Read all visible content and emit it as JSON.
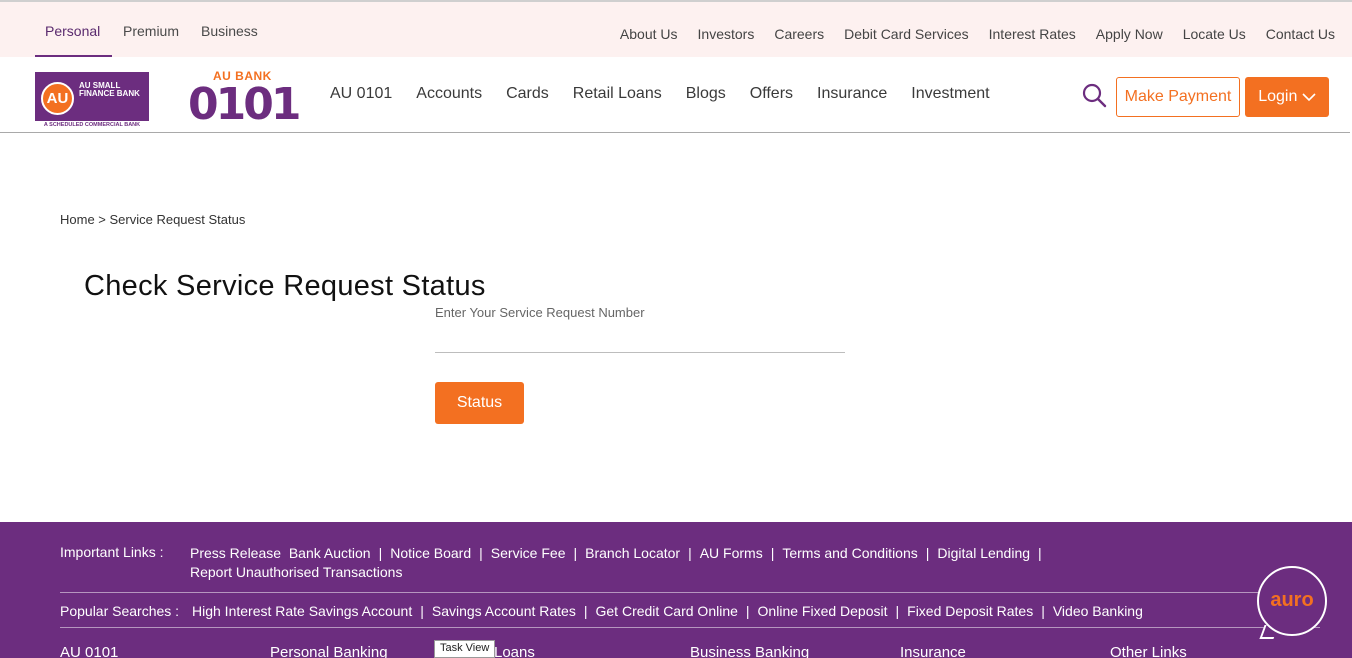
{
  "topbar": {
    "segments": [
      "Personal",
      "Premium",
      "Business"
    ],
    "links": [
      "About Us",
      "Investors",
      "Careers",
      "Debit Card Services",
      "Interest Rates",
      "Apply Now",
      "Locate Us",
      "Contact Us"
    ]
  },
  "logo": {
    "circle": "AU",
    "text": "AU SMALL FINANCE BANK",
    "strip": "A SCHEDULED COMMERCIAL BANK",
    "bank_small": "AU BANK",
    "bank_big": "0101"
  },
  "nav": {
    "items": [
      "AU 0101",
      "Accounts",
      "Cards",
      "Retail Loans",
      "Blogs",
      "Offers",
      "Insurance",
      "Investment"
    ],
    "make_payment": "Make Payment",
    "login": "Login"
  },
  "breadcrumb": "Home > Service Request Status",
  "page_title": "Check Service Request Status",
  "form": {
    "label": "Enter Your Service Request Number",
    "value": "",
    "status_button": "Status"
  },
  "footer": {
    "important_label": "Important Links :",
    "important_links": [
      "Press Release",
      "Bank Auction",
      "Notice Board",
      "Service Fee",
      "Branch Locator",
      "AU Forms",
      "Terms and Conditions",
      "Digital Lending",
      "Report Unauthorised Transactions"
    ],
    "popular_label": "Popular Searches :",
    "popular_links": [
      "High Interest Rate Savings Account",
      "Savings Account Rates",
      "Get Credit Card Online",
      "Online Fixed Deposit",
      "Fixed Deposit Rates",
      "Video Banking"
    ],
    "columns": [
      "AU 0101",
      "Personal Banking",
      "Loans",
      "Business Banking",
      "Insurance",
      "Other Links"
    ]
  },
  "auro": "auro",
  "tooltip": "Task View",
  "colors": {
    "purple": "#6c2d7f",
    "orange": "#f37021"
  }
}
